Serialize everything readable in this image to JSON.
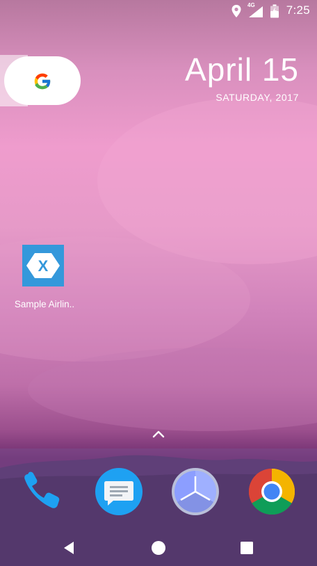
{
  "status_bar": {
    "network": "4G",
    "time": "7:25",
    "icons": [
      "location-icon",
      "cell-signal-icon",
      "battery-charging-icon"
    ]
  },
  "search_widget": {
    "icon": "google-g-icon"
  },
  "date_widget": {
    "date": "April 15",
    "weekday_year": "SATURDAY, 2017"
  },
  "home_apps": [
    {
      "label": "Sample Airlin..",
      "icon": "xamarin-x-icon",
      "color": "#3498db"
    }
  ],
  "app_drawer": {
    "icon": "chevron-up-icon"
  },
  "dock": {
    "apps": [
      {
        "name": "Phone",
        "icon": "phone-icon",
        "color": "#1ea1f2"
      },
      {
        "name": "Messages",
        "icon": "message-icon",
        "color": "#1ea1f2"
      },
      {
        "name": "Clock",
        "icon": "clock-icon",
        "color": "#8c9eff"
      },
      {
        "name": "Chrome",
        "icon": "chrome-icon",
        "color": "#db4437"
      }
    ]
  },
  "nav_bar": {
    "back": "back-icon",
    "home": "home-icon",
    "recents": "recents-icon"
  }
}
